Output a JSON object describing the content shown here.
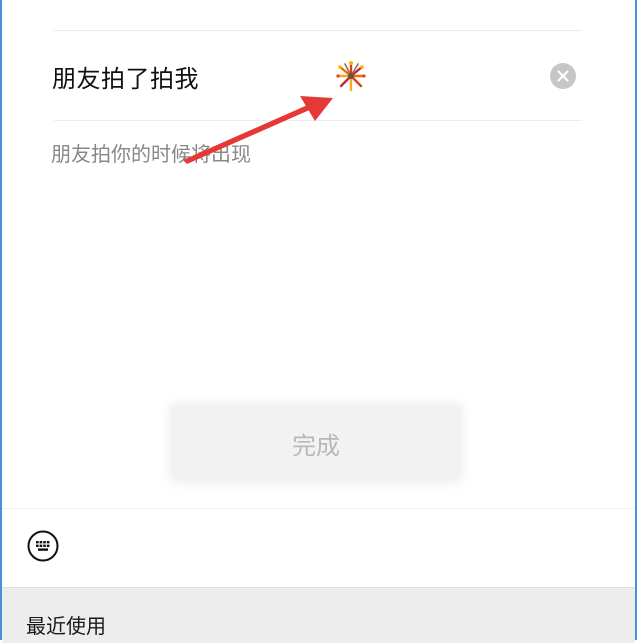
{
  "pat_input": {
    "value": "朋友拍了拍我",
    "emoji": "fireworks-emoji",
    "clear_icon": "close-circle-icon"
  },
  "hint": "朋友拍你的时候将出现",
  "done_button": {
    "label": "完成"
  },
  "toolbar": {
    "keyboard_icon": "keyboard-icon"
  },
  "recent_panel": {
    "label": "最近使用"
  },
  "colors": {
    "annotation_arrow": "#e53935",
    "frame_border": "#4a90d9",
    "done_disabled_text": "#b8b8b8"
  }
}
